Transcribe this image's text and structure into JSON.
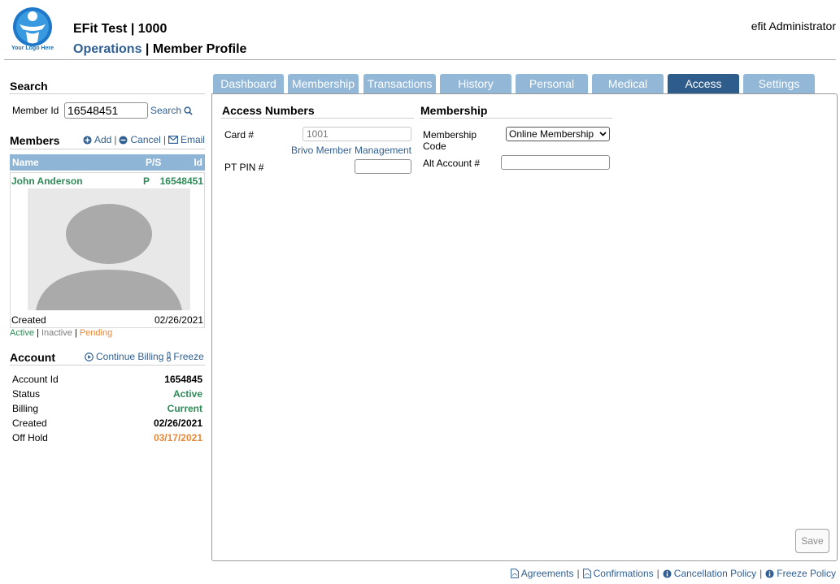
{
  "header": {
    "logo_text": "Your Logo Here",
    "title": "EFit Test | 1000",
    "breadcrumb_section": "Operations",
    "breadcrumb_separator": "|",
    "breadcrumb_page": "Member Profile",
    "user": "efit Administrator"
  },
  "search": {
    "title": "Search",
    "member_id_label": "Member Id",
    "member_id_value": "16548451",
    "search_label": "Search"
  },
  "members": {
    "title": "Members",
    "add_label": "Add",
    "cancel_label": "Cancel",
    "email_label": "Email",
    "separator": "|",
    "columns": {
      "name": "Name",
      "ps": "P/S",
      "id": "Id"
    },
    "row": {
      "name": "John Anderson",
      "ps": "P",
      "id": "16548451"
    },
    "created_label": "Created",
    "created_value": "02/26/2021",
    "legend": {
      "active": "Active",
      "inactive": "Inactive",
      "pending": "Pending",
      "separator": "|"
    }
  },
  "account": {
    "title": "Account",
    "continue_billing_label": "Continue Billing",
    "freeze_label": "Freeze",
    "rows": [
      {
        "label": "Account Id",
        "value": "1654845"
      },
      {
        "label": "Status",
        "value": "Active"
      },
      {
        "label": "Billing",
        "value": "Current"
      },
      {
        "label": "Created",
        "value": "02/26/2021"
      },
      {
        "label": "Off Hold",
        "value": "03/17/2021"
      }
    ]
  },
  "tabs": [
    {
      "label": "Dashboard"
    },
    {
      "label": "Membership"
    },
    {
      "label": "Transactions"
    },
    {
      "label": "History"
    },
    {
      "label": "Personal"
    },
    {
      "label": "Medical"
    },
    {
      "label": "Access"
    },
    {
      "label": "Settings"
    }
  ],
  "active_tab": "Access",
  "access": {
    "title": "Access Numbers",
    "card_label": "Card #",
    "card_placeholder": "1001",
    "brivo_link": "Brivo Member Management",
    "pt_pin_label": "PT PIN #",
    "pt_pin_value": ""
  },
  "membership": {
    "title": "Membership",
    "code_label_line1": "Membership",
    "code_label_line2": "Code",
    "code_selected": "Online Membership",
    "alt_account_label": "Alt Account #",
    "alt_account_value": ""
  },
  "save_label": "Save",
  "footer": {
    "agreements": "Agreements",
    "confirmations": "Confirmations",
    "cancellation_policy": "Cancellation Policy",
    "freeze_policy": "Freeze Policy",
    "separator": "|"
  },
  "colors": {
    "link_blue": "#2f5f93",
    "tab_inactive": "#92b7d7",
    "tab_active": "#2e5d8c",
    "active_green": "#2e8b57",
    "pending_orange": "#e6893a"
  }
}
